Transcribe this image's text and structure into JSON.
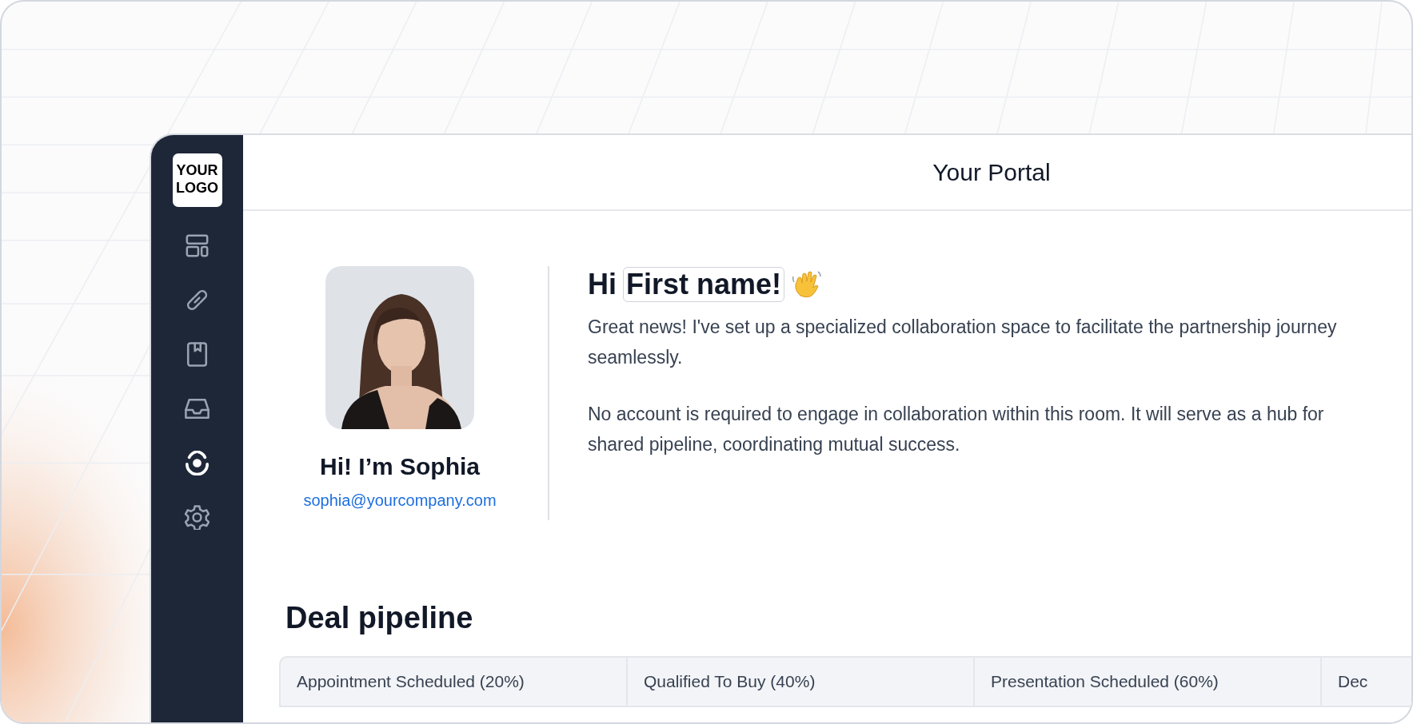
{
  "sidebar": {
    "logo": "YOUR LOGO",
    "items": [
      {
        "kind": "layout",
        "selected": false
      },
      {
        "kind": "link",
        "selected": false
      },
      {
        "kind": "book",
        "selected": false
      },
      {
        "kind": "inbox",
        "selected": false
      },
      {
        "kind": "target",
        "selected": true
      },
      {
        "kind": "settings",
        "selected": false
      }
    ]
  },
  "header": {
    "title": "Your Portal"
  },
  "profile": {
    "name": "Hi! I’m Sophia",
    "email": "sophia@yourcompany.com"
  },
  "greeting": {
    "prefix": "Hi",
    "name_token": "First name!"
  },
  "paragraphs": [
    [
      "Great news! I've set up a specialized collaboration space to facilitate the partnership journey",
      "seamlessly."
    ],
    [
      "No account is required to engage in collaboration within this room. It will serve as a hub for",
      "shared pipeline, coordinating mutual success."
    ]
  ],
  "pipeline": {
    "title": "Deal pipeline",
    "columns": [
      "Appointment Scheduled (20%)",
      "Qualified To Buy (40%)",
      "Presentation Scheduled (60%)",
      "Dec"
    ]
  }
}
